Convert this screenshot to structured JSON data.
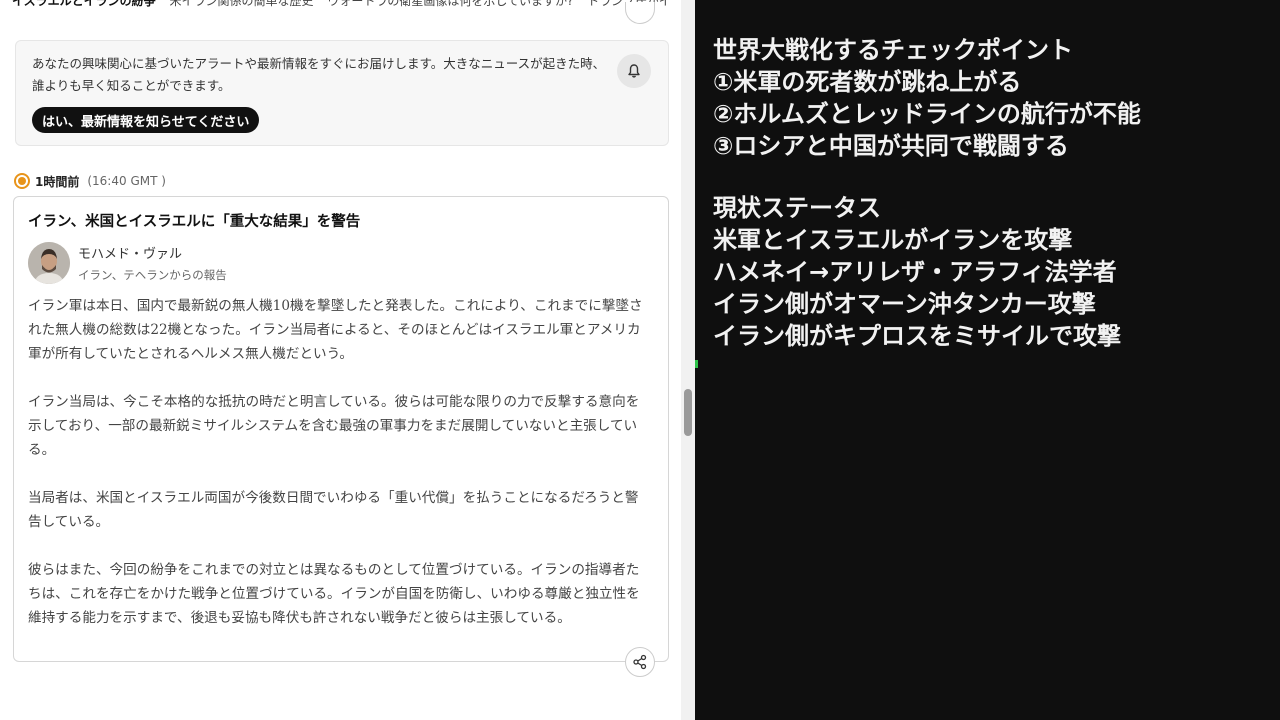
{
  "top_nav": {
    "items": [
      "イスラエルとイランの紛争",
      "米イラン関係の簡単な歴史",
      "ウォートラの衛星画像は何を示していますか?",
      "トランプ氏がイ"
    ]
  },
  "alert_card": {
    "text": "あなたの興味関心に基づいたアラートや最新情報をすぐにお届けします。大きなニュースが起きた時、誰よりも早く知ることができます。",
    "button_label": "はい、最新情報を知らせてください",
    "icon": "bell-icon"
  },
  "live_update": {
    "time_relative": "1時間前",
    "time_gmt": "(16:40 GMT )"
  },
  "article": {
    "title": "イラン、米国とイスラエルに「重大な結果」を警告",
    "author_name": "モハメド・ヴァル",
    "author_location": "イラン、テヘランからの報告",
    "paragraphs": [
      "イラン軍は本日、国内で最新鋭の無人機10機を撃墜したと発表した。これにより、これまでに撃墜された無人機の総数は22機となった。イラン当局者によると、そのほとんどはイスラエル軍とアメリカ軍が所有していたとされるヘルメス無人機だという。",
      "イラン当局は、今こそ本格的な抵抗の時だと明言している。彼らは可能な限りの力で反撃する意向を示しており、一部の最新鋭ミサイルシステムを含む最強の軍事力をまだ展開していないと主張している。",
      "当局者は、米国とイスラエル両国が今後数日間でいわゆる「重い代償」を払うことになるだろうと警告している。",
      "彼らはまた、今回の紛争をこれまでの対立とは異なるものとして位置づけている。イランの指導者たちは、これを存亡をかけた戦争と位置づけている。イランが自国を防衛し、いわゆる尊厳と独立性を維持する能力を示すまで、後退も妥協も降伏も許されない戦争だと彼らは主張している。"
    ],
    "share_icon": "share-icon"
  },
  "notes": {
    "block1": [
      "世界大戦化するチェックポイント",
      "①米軍の死者数が跳ね上がる",
      "②ホルムズとレッドラインの航行が不能",
      "③ロシアと中国が共同で戦闘する"
    ],
    "block2": [
      "現状ステータス",
      "米軍とイスラエルがイランを攻撃",
      "ハメネイ→アリレザ・アラフィ法学者",
      "イラン側がオマーン沖タンカー攻撃",
      "イラン側がキプロスをミサイルで攻撃"
    ]
  },
  "colors": {
    "live_accent": "#e8941a",
    "notes_background": "#0f0f0f",
    "notes_text": "#f2f2f2",
    "button_background": "#111111"
  }
}
